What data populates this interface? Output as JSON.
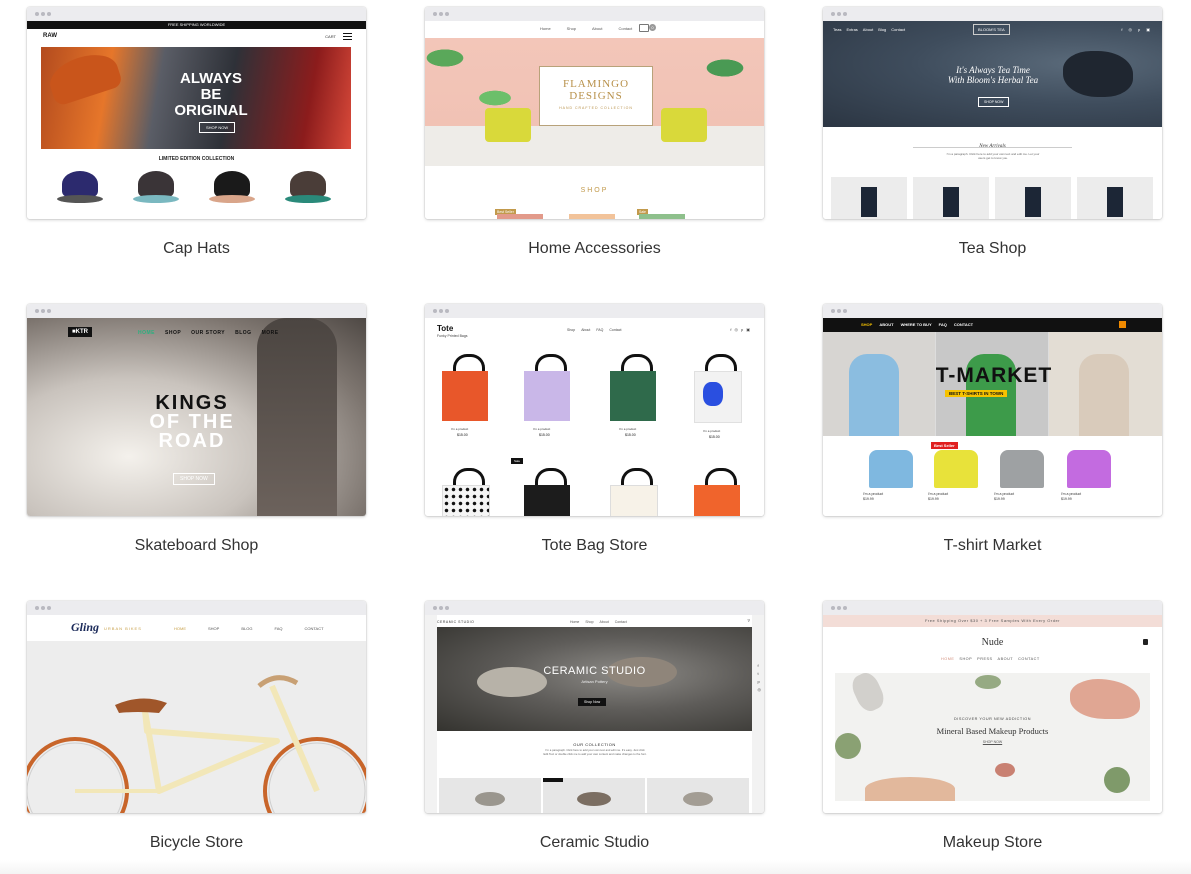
{
  "captions": {
    "cap_hats": "Cap Hats",
    "home_accessories": "Home Accessories",
    "tea_shop": "Tea Shop",
    "skateboard_shop": "Skateboard Shop",
    "tote_bag_store": "Tote Bag Store",
    "tshirt_market": "T-shirt Market",
    "bicycle_store": "Bicycle Store",
    "ceramic_studio": "Ceramic Studio",
    "makeup_store": "Makeup Store"
  },
  "previews": {
    "cap": {
      "banner": "FREE SHIPPING WORLDWIDE",
      "logo": "RAW",
      "cart": "CART",
      "hero_line1": "ALWAYS BE",
      "hero_line2": "ORIGINAL",
      "hero_button": "SHOP NOW",
      "section": "LIMITED EDITION COLLECTION",
      "cap_colors": [
        "#2c2a6e",
        "#3a3437",
        "#1a1a1a",
        "#4a3d38"
      ],
      "brim_colors": [
        "#333",
        "#7ab",
        "#d9a",
        "#2a8a7a"
      ]
    },
    "home": {
      "nav": [
        "Home",
        "Shop",
        "About",
        "Contact"
      ],
      "badge": "0",
      "title_line1": "FLAMINGO",
      "title_line2": "DESIGNS",
      "subtitle": "HAND CRAFTED COLLECTION",
      "section": "SHOP",
      "tags": [
        "Best Seller",
        "Sale"
      ]
    },
    "tea": {
      "nav": [
        "Teas",
        "Extras",
        "About",
        "Blog",
        "Contact"
      ],
      "logo": "BLOOM'S TEA",
      "hero_line1": "It's Always Tea Time",
      "hero_line2": "With Bloom's Herbal Tea",
      "hero_button": "SHOP NOW",
      "section": "New Arrivals",
      "blurb": "I'm a paragraph. Click here to add your own text and edit me. Let your users get to know you."
    },
    "skate": {
      "logo": "■KTR",
      "nav": [
        "HOME",
        "SHOP",
        "OUR STORY",
        "BLOG",
        "MORE"
      ],
      "hero_line1": "KINGS",
      "hero_line2": "OF THE",
      "hero_line3": "ROAD",
      "hero_button": "SHOP NOW"
    },
    "tote": {
      "logo": "Tote",
      "tagline": "Funky Printed Bags",
      "nav": [
        "Shop",
        "About",
        "FAQ",
        "Contact"
      ],
      "product_name": "I'm a product",
      "price": "$15.00",
      "sale": "Sale",
      "bag_colors": [
        "#e8572a",
        "#c9b7e8",
        "#2f6a4b",
        "#f2f2f2",
        "#f5f5f5",
        "#1c1c1c",
        "#f7f2e8",
        "#f0642c"
      ]
    },
    "tshirt": {
      "nav": [
        "SHOP",
        "ABOUT",
        "WHERE TO BUY",
        "FAQ",
        "CONTACT"
      ],
      "hero_title": "T-MARKET",
      "hero_sub": "BEST T-SHIRTS IN TOWN",
      "badge": "Best Seller",
      "product_name": "I'm a product",
      "price": "$19.99",
      "shirt_colors": [
        "#7fb8e0",
        "#e8e23a",
        "#9ea1a3",
        "#c36be0"
      ]
    },
    "bike": {
      "logo": "Gling",
      "logo_sub": "URBAN BIKES",
      "nav": [
        "HOME",
        "SHOP",
        "BLOG",
        "FAQ",
        "CONTACT"
      ]
    },
    "ceramic": {
      "logo": "CERAMIC STUDIO",
      "nav": [
        "Home",
        "Shop",
        "About",
        "Contact"
      ],
      "hero_title": "CERAMIC STUDIO",
      "hero_sub": "Artisan Pottery",
      "hero_button": "Shop Now",
      "section": "OUR COLLECTION",
      "blurb": "I'm a paragraph. Click here to add your own text and edit me. It's easy. Just click Edit Text or double click me to add your own content and make changes to the font."
    },
    "makeup": {
      "banner": "Free Shipping Over $30 + 3 Free Samples With Every Order",
      "logo": "Nude",
      "nav": [
        "HOME",
        "SHOP",
        "PRESS",
        "ABOUT",
        "CONTACT"
      ],
      "eyebrow": "DISCOVER YOUR NEW ADDICTION",
      "headline": "Mineral Based Makeup Products",
      "link": "SHOP NOW"
    }
  }
}
